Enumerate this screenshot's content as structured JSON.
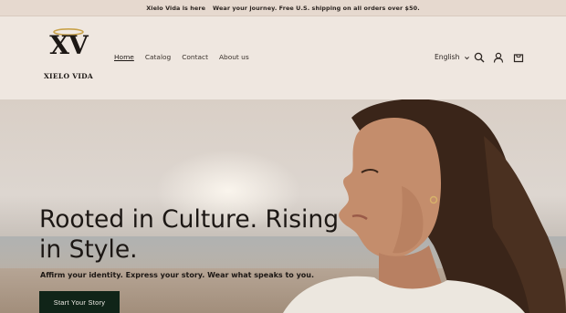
{
  "announcement": {
    "brand": "Xielo Vida is here",
    "message": "Wear your journey. Free U.S. shipping on all orders over $50."
  },
  "logo": {
    "monogram": "XV",
    "name": "XIELO VIDA"
  },
  "nav": {
    "items": [
      {
        "label": "Home",
        "active": true
      },
      {
        "label": "Catalog",
        "active": false
      },
      {
        "label": "Contact",
        "active": false
      },
      {
        "label": "About us",
        "active": false
      }
    ]
  },
  "header_tools": {
    "language": "English",
    "icons": [
      "search-icon",
      "account-icon",
      "cart-icon"
    ]
  },
  "hero": {
    "title": "Rooted in Culture. Rising in Style.",
    "subtitle": "Affirm your identity. Express your story. Wear what speaks to you.",
    "cta_label": "Start Your Story"
  },
  "colors": {
    "announcement_bg": "#e6d9cf",
    "header_bg": "#efe7e0",
    "cta_bg": "#102418",
    "text": "#1c1714",
    "halo_gold": "#c9a24a"
  }
}
